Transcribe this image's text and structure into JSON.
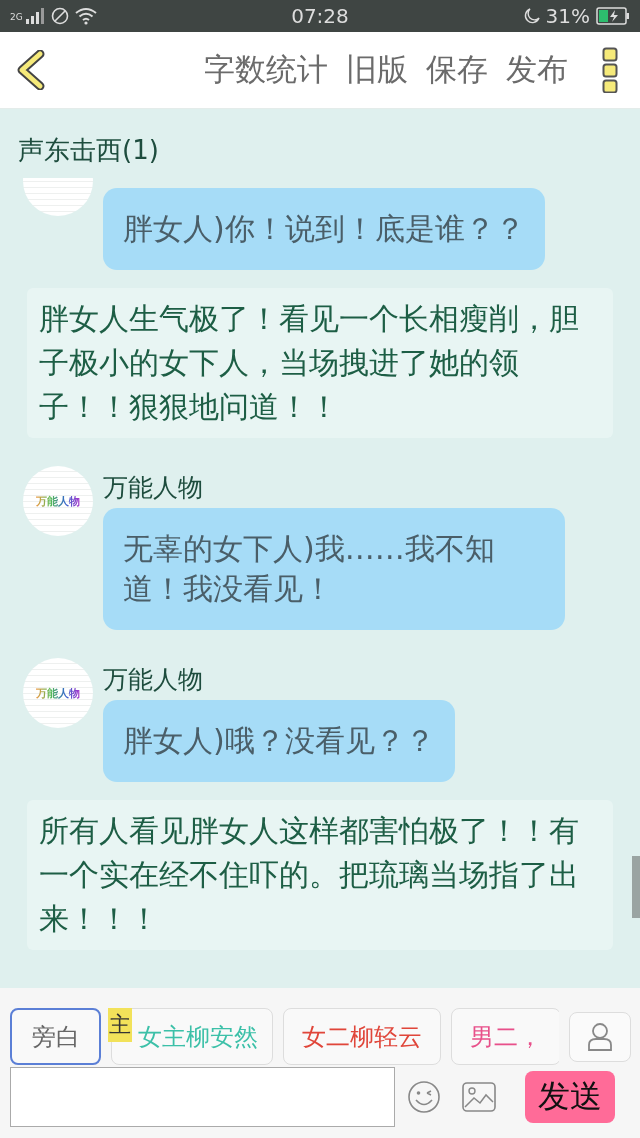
{
  "status_bar": {
    "network": "2G",
    "time": "07:28",
    "battery": "31%"
  },
  "toolbar": {
    "actions": [
      "字数统计",
      "旧版",
      "保存",
      "发布"
    ]
  },
  "chat": {
    "title": "声东击西(1)",
    "items": [
      {
        "kind": "message",
        "bubble": "胖女人)你！说到！底是谁？？"
      },
      {
        "kind": "narration",
        "text": "胖女人生气极了！看见一个长相瘦削，胆子极小的女下人，当场拽进了她的领子！！狠狠地问道！！"
      },
      {
        "kind": "message",
        "name": "万能人物",
        "avatar_text": "万能人物",
        "bubble": "无辜的女下人)我……我不知道！我没看见！"
      },
      {
        "kind": "message",
        "name": "万能人物",
        "avatar_text": "万能人物",
        "bubble": "胖女人)哦？没看见？？"
      },
      {
        "kind": "narration",
        "text": "所有人看见胖女人这样都害怕极了！！有一个实在经不住吓的。把琉璃当场指了出来！！！"
      }
    ]
  },
  "roles": [
    {
      "label": "旁白",
      "selected": true,
      "color": "#666666"
    },
    {
      "label": "女主柳安然",
      "selected": false,
      "color": "#3cc0a8",
      "badge": "主"
    },
    {
      "label": "女二柳轻云",
      "selected": false,
      "color": "#e0463a"
    },
    {
      "label": "男二，",
      "selected": false,
      "color": "#e8508a"
    }
  ],
  "composer": {
    "send": "发送"
  }
}
